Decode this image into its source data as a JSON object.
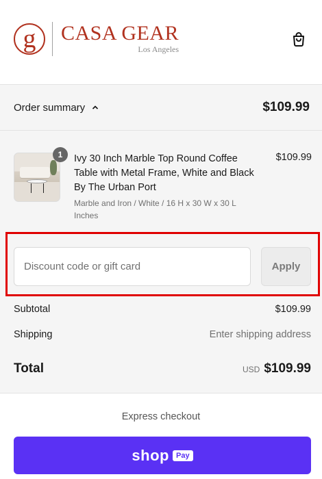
{
  "brand": {
    "logo_mark": "g",
    "name": "CASA GEAR",
    "subtitle": "Los Angeles",
    "color": "#b1321f"
  },
  "header": {
    "cart_icon": "shopping-bag-icon"
  },
  "order_summary": {
    "toggle_label": "Order summary",
    "toggle_icon": "chevron-up-icon",
    "total": "$109.99"
  },
  "items": [
    {
      "quantity": "1",
      "title": "Ivy 30 Inch Marble Top Round Coffee Table with Metal Frame, White and Black By The Urban Port",
      "variant": "Marble and Iron / White / 16 H x 30 W x 30 L Inches",
      "price": "$109.99"
    }
  ],
  "discount": {
    "placeholder": "Discount code or gift card",
    "value": "",
    "apply_label": "Apply"
  },
  "totals": {
    "subtotal_label": "Subtotal",
    "subtotal_value": "$109.99",
    "shipping_label": "Shipping",
    "shipping_value": "Enter shipping address",
    "total_label": "Total",
    "currency": "USD",
    "total_value": "$109.99"
  },
  "express": {
    "label": "Express checkout",
    "shop_word": "shop",
    "pay_word": "Pay",
    "button_color": "#5a31f4"
  },
  "highlight_color": "#e00000"
}
